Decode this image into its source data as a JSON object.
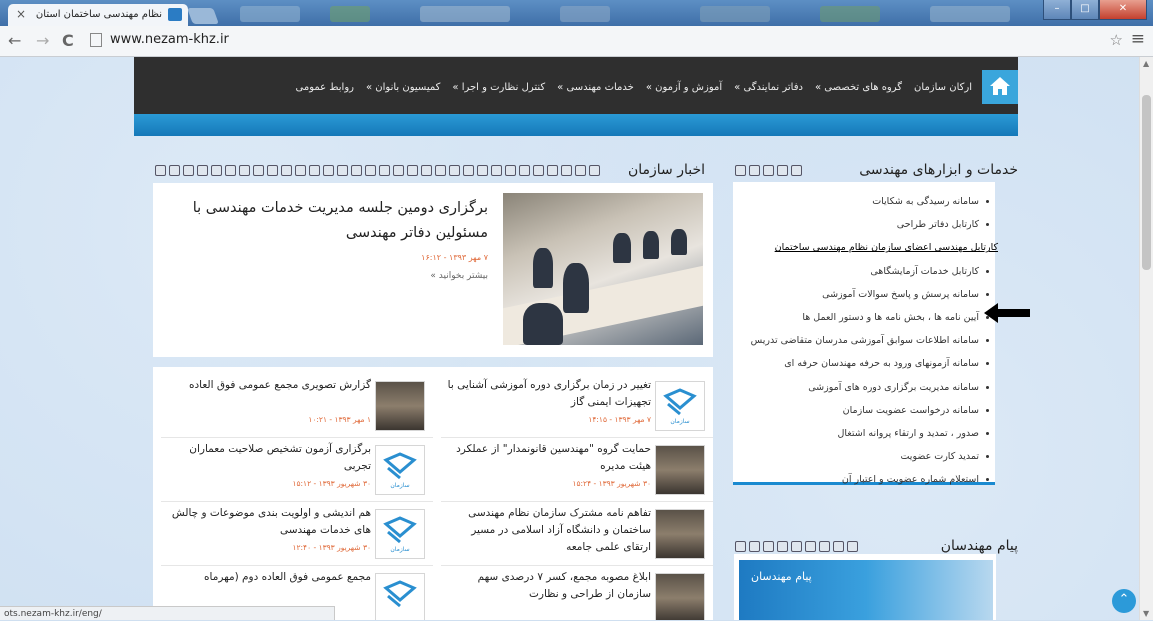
{
  "browser": {
    "tab_title": "نظام مهندسی ساختمان استان",
    "tab_close": "×",
    "url": "www.nezam-khz.ir",
    "back": "←",
    "forward": "→",
    "reload": "C",
    "star": "☆",
    "menu": "≡",
    "status_url": "ots.nezam-khz.ir/eng/"
  },
  "nav": {
    "home_icon": "home-icon",
    "items": [
      "ارکان سازمان",
      "گروه های تخصصی »",
      "دفاتر نمایندگی »",
      "آموزش و آزمون »",
      "خدمات مهندسی »",
      "کنترل نظارت و اجرا »",
      "کمیسیون بانوان »",
      "روابط عمومی"
    ]
  },
  "services": {
    "title": "خدمات و ابزارهای مهندسی",
    "items": [
      "سامانه رسیدگی به شکایات",
      "کارتابل دفاتر طراحی",
      "کارتابل مهندسی اعضای سازمان نظام مهندسی ساختمان",
      "کارتابل خدمات آزمایشگاهی",
      "سامانه پرسش و پاسخ سوالات آموزشی",
      "آیین نامه ها ، بخش نامه ها و دستور العمل ها",
      "سامانه اطلاعات سوابق آموزشی مدرسان متقاضی تدریس",
      "سامانه آزمونهای ورود به حرفه مهندسان حرفه ای",
      "سامانه مدیریت برگزاری دوره های آموزشی",
      "سامانه درخواست عضویت سازمان",
      "صدور ، تمدید و ارتقاء پروانه اشتغال",
      "تمدید کارت عضویت",
      "استعلام شماره عضویت و اعتبار آن"
    ]
  },
  "message": {
    "title": "پیام مهندسان",
    "banner_text": "پیام مهندسان"
  },
  "news": {
    "title": "اخبار سازمان",
    "featured": {
      "title": "برگزاری دومین جلسه مدیریت خدمات مهندسی با مسئولین دفاتر مهندسی",
      "date": "۷ مهر ۱۳۹۳ - ۱۶:۱۲",
      "more": "بیشتر بخوانید »"
    },
    "items": [
      {
        "title": "تغییر در زمان برگزاری دوره آموزشی آشنایی با تجهیزات ایمنی گاز",
        "date": "۷ مهر ۱۳۹۳ - ۱۴:۱۵",
        "thumb": "logo"
      },
      {
        "title": "گزارش تصویری مجمع عمومی فوق العاده",
        "date": "۱ مهر ۱۳۹۳ - ۱۰:۲۱",
        "thumb": "photo"
      },
      {
        "title": "حمایت گروه \"مهندسین قانونمدار\" از عملکرد هیئت مدیره",
        "date": "۳۰ شهریور ۱۳۹۳ - ۱۵:۲۴",
        "thumb": "photo"
      },
      {
        "title": "برگزاری آزمون تشخیص صلاحیت معماران تجربی",
        "date": "۳۰ شهریور ۱۳۹۳ - ۱۵:۱۲",
        "thumb": "logo"
      },
      {
        "title": "تفاهم نامه مشترک سازمان نظام مهندسی ساختمان و دانشگاه آزاد اسلامی در مسیر ارتقای علمی جامعه",
        "date": "",
        "thumb": "photo"
      },
      {
        "title": "هم اندیشی و اولویت بندی موضوعات و چالش های خدمات مهندسی",
        "date": "۳۰ شهریور ۱۳۹۳ - ۱۲:۴۰",
        "thumb": "logo"
      },
      {
        "title": "ابلاغ مصوبه مجمع، کسر ۷ درصدی سهم سازمان از طراحی و نظارت",
        "date": "",
        "thumb": "photo"
      },
      {
        "title": "مجمع عمومی فوق العاده دوم (مهرماه",
        "date": "",
        "thumb": "logo"
      }
    ]
  },
  "colors": {
    "accent": "#1a8ad0",
    "nav_bg": "#2f2f2f",
    "date": "#e06a3a"
  }
}
